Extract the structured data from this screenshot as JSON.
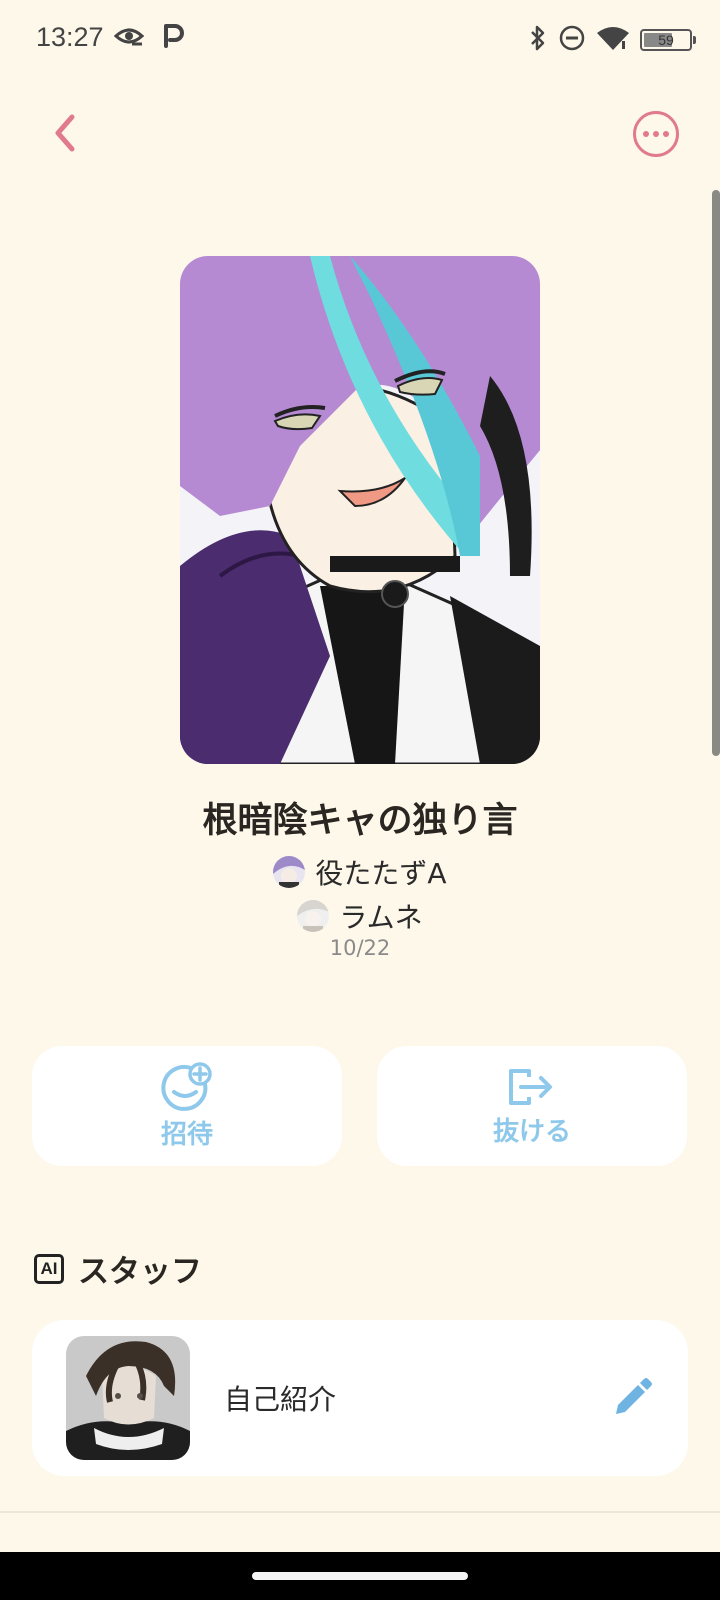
{
  "status_bar": {
    "time": "13:27",
    "battery": "59",
    "icons": [
      "eye-icon",
      "p-app-icon",
      "bluetooth-icon",
      "do-not-disturb-icon",
      "wifi-icon",
      "battery-icon"
    ]
  },
  "header": {
    "back_icon": "chevron-left-icon",
    "more_icon": "more-dots-icon"
  },
  "room": {
    "title": "根暗陰キャの独り言",
    "members": [
      {
        "name": "役たたずA"
      },
      {
        "name": "ラムネ"
      }
    ],
    "date": "10/22"
  },
  "actions": {
    "invite_label": "招待",
    "leave_label": "抜ける"
  },
  "staff": {
    "badge": "AI",
    "title": "スタッフ",
    "intro_label": "自己紹介"
  },
  "colors": {
    "background": "#fdf8ea",
    "accent_pink": "#e07a8c",
    "accent_blue": "#8ec8ea"
  }
}
